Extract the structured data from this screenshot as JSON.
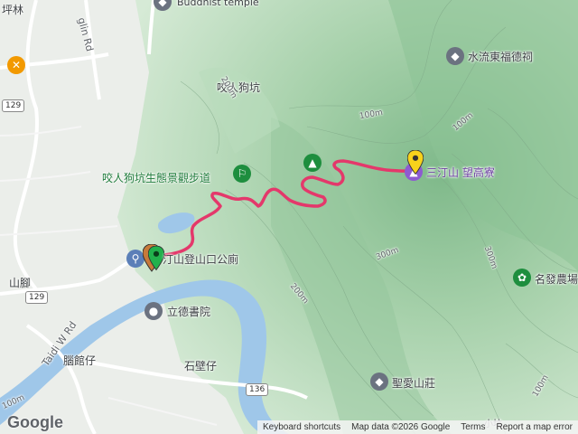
{
  "map": {
    "labels": {
      "buddhist_temple": "Buddhist temple",
      "pinglin": "坪林",
      "gonglin_rd": "glin Rd",
      "yaoren_gou_keng": "咬人狗坑",
      "eco_trail": "咬人狗坑生態景觀步道",
      "shuiliu_temple": "水流東福德祠",
      "trail_toilet": "汀山登山口公廁",
      "sanding_shan": "三汀山 望高寮",
      "shan_jiao": "山腳",
      "taidi_w_rd": "Taidi W Rd",
      "lide_academy": "立德書院",
      "naoguan_zai": "腦館仔",
      "shibi_zai": "石壁仔",
      "shengai_villa": "聖愛山莊",
      "mingfa_farm": "名發農場",
      "xiaogong": "小坑",
      "contour_100a": "100m",
      "contour_100b": "100m",
      "contour_200a": "200m",
      "contour_200b": "200m",
      "contour_300a": "300m",
      "contour_300b": "300m",
      "contour_100c": "100m",
      "contour_100d": "100m"
    },
    "shields": {
      "r129a": "129",
      "r129b": "129",
      "r136": "136"
    },
    "colors": {
      "route": "#e4386b",
      "river": "#9fc7e9",
      "hill_light": "#cfe6cf",
      "hill_mid": "#a9d3ae",
      "hill_dark": "#86bf90",
      "urban": "#ececec",
      "poi_green": "#1e8e3e",
      "poi_blue": "#5b7fb8",
      "poi_gray": "#6b7280",
      "pin_green": "#22b14c",
      "pin_yellow": "#f7d21c"
    }
  },
  "footer": {
    "logo": "Google",
    "keyboard": "Keyboard shortcuts",
    "mapdata": "Map data ©2026 Google",
    "terms": "Terms",
    "report": "Report a map error"
  }
}
